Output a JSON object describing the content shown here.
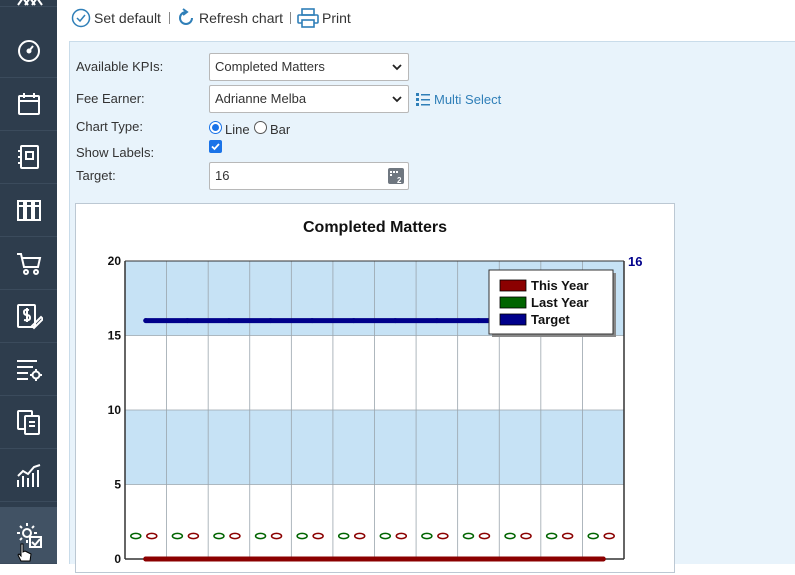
{
  "toolbar": {
    "set_default_label": "Set default",
    "refresh_chart_label": "Refresh chart",
    "print_label": "Print"
  },
  "form": {
    "available_kpis_label": "Available KPIs:",
    "available_kpis_value": "Completed Matters",
    "fee_earner_label": "Fee Earner:",
    "fee_earner_value": "Adrianne Melba",
    "multi_select_label": "Multi Select",
    "chart_type_label": "Chart Type:",
    "chart_type_line": "Line",
    "chart_type_bar": "Bar",
    "chart_type_selected": "Line",
    "show_labels_label": "Show Labels:",
    "show_labels_checked": true,
    "target_label": "Target:",
    "target_value": "16"
  },
  "colors": {
    "sidebar_bg": "#2e3d4d",
    "panel_bg": "#e8f3fb",
    "accent": "#1a73e8",
    "link": "#2f7fb8",
    "this_year": "#8b0000",
    "last_year": "#006400",
    "target": "#00008b",
    "band": "#c6e2f5"
  },
  "sidebar": {
    "icons": [
      "team-icon",
      "dashboard-gauge-icon",
      "archive-box-icon",
      "notebook-icon",
      "library-books-icon",
      "shopping-cart-icon",
      "billing-edit-icon",
      "list-settings-icon",
      "documents-icon",
      "analytics-chart-icon",
      "settings-report-icon"
    ]
  },
  "chart_data": {
    "type": "line",
    "title": "Completed Matters",
    "ylim": [
      0,
      20
    ],
    "yticks": [
      0,
      5,
      10,
      15,
      20
    ],
    "target_label": "16",
    "legend_placement": "top-right",
    "grid": true,
    "categories": [
      "",
      "",
      "",
      "",
      "",
      "",
      "",
      "",
      "",
      "",
      "",
      ""
    ],
    "series": [
      {
        "name": "This Year",
        "color": "#8b0000",
        "values": [
          0,
          0,
          0,
          0,
          0,
          0,
          0,
          0,
          0,
          0,
          0,
          0
        ]
      },
      {
        "name": "Last Year",
        "color": "#006400",
        "values": [
          0,
          0,
          0,
          0,
          0,
          0,
          0,
          0,
          0,
          0,
          0,
          0
        ]
      },
      {
        "name": "Target",
        "color": "#00008b",
        "values": [
          16,
          16,
          16,
          16,
          16,
          16,
          16,
          16,
          16,
          16,
          16,
          16
        ]
      }
    ]
  }
}
